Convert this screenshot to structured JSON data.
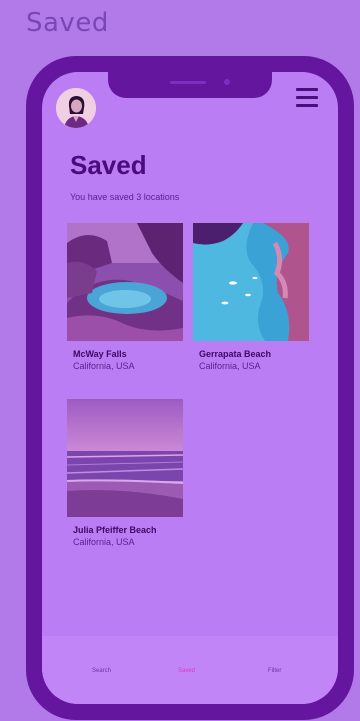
{
  "page": {
    "heading": "Saved"
  },
  "screen": {
    "title": "Saved",
    "subtitle": "You have saved 3 locations"
  },
  "locations": [
    {
      "name": "McWay Falls",
      "region": "California, USA",
      "image": "waterfall-cove-photo"
    },
    {
      "name": "Gerrapata Beach",
      "region": "California, USA",
      "image": "aerial-beach-photo"
    },
    {
      "name": "Julia Pfeiffer Beach",
      "region": "California, USA",
      "image": "sunset-beach-photo"
    }
  ],
  "nav": {
    "items": [
      {
        "label": "Search",
        "active": false
      },
      {
        "label": "Saved",
        "active": true
      },
      {
        "label": "Filter",
        "active": false
      }
    ]
  },
  "icons": {
    "avatar": "user-avatar",
    "menu": "hamburger-menu-icon"
  },
  "colors": {
    "background": "#b27ae8",
    "phone_frame": "#64169e",
    "screen": "#bb7df3",
    "title": "#4a0b7d",
    "active_nav": "#d33fc0"
  }
}
